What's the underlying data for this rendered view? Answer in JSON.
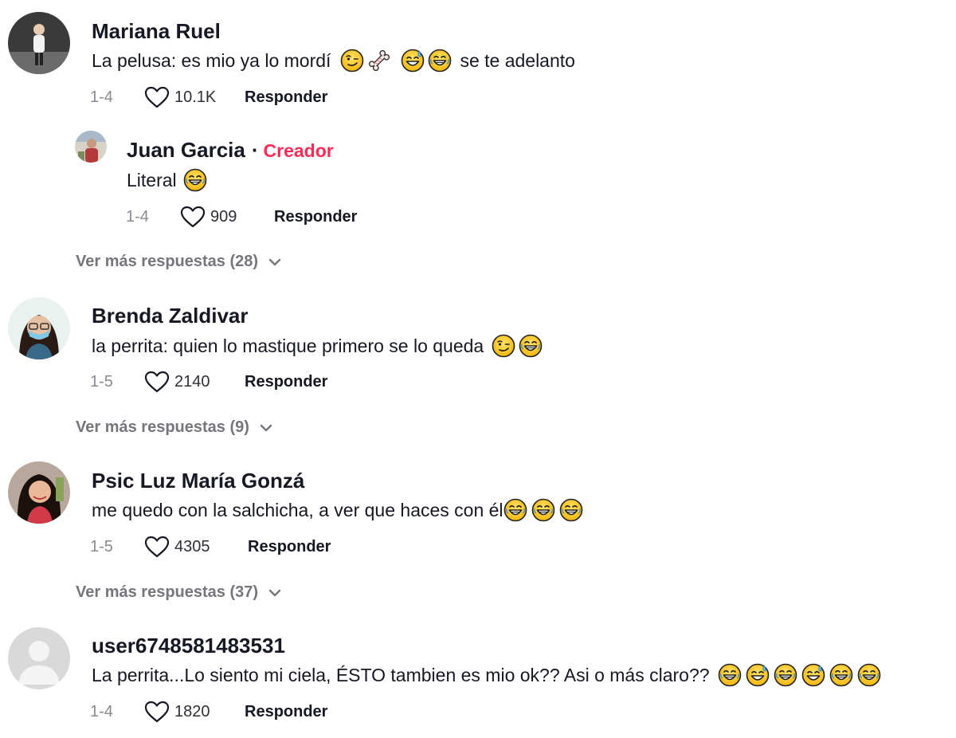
{
  "comments": [
    {
      "username": "Mariana Ruel",
      "text_before": "La pelusa: es mio ya lo mordí",
      "text_after": "se te adelanto",
      "emojis": [
        "smirk-face-icon",
        "bone-icon",
        "sweat-smile-icon",
        "laughing-face-icon"
      ],
      "date": "1-4",
      "likes": "10.1K",
      "reply_label": "Responder",
      "replies": [
        {
          "username": "Juan Garcia",
          "creator_dot": "·",
          "creator_label": "Creador",
          "text": "Literal",
          "emojis": [
            "laughing-face-icon"
          ],
          "date": "1-4",
          "likes": "909",
          "reply_label": "Responder"
        }
      ],
      "more_label": "Ver más respuestas (28)"
    },
    {
      "username": "Brenda Zaldivar",
      "text": "la perrita: quien lo mastique primero se lo queda",
      "emojis": [
        "smirk-face-icon",
        "laughing-face-icon"
      ],
      "date": "1-5",
      "likes": "2140",
      "reply_label": "Responder",
      "more_label": "Ver más respuestas (9)"
    },
    {
      "username": "Psic Luz María Gonzá",
      "text": "me quedo con la salchicha, a ver que haces con él",
      "emojis": [
        "laughing-face-icon",
        "laughing-face-icon",
        "laughing-face-icon"
      ],
      "date": "1-5",
      "likes": "4305",
      "reply_label": "Responder",
      "more_label": "Ver más respuestas (37)"
    },
    {
      "username": "user6748581483531",
      "text": "La perrita...Lo siento mi ciela, ÉSTO tambien es mio ok?? Asi o más claro??",
      "emojis": [
        "laughing-face-icon",
        "sweat-smile-icon",
        "laughing-face-icon",
        "sweat-smile-icon",
        "laughing-face-icon",
        "laughing-face-icon"
      ],
      "date": "1-4",
      "likes": "1820",
      "reply_label": "Responder"
    }
  ],
  "colors": {
    "creator": "#fe2c55",
    "username": "#161823",
    "muted": "#8a8b91",
    "more": "#75767c"
  }
}
